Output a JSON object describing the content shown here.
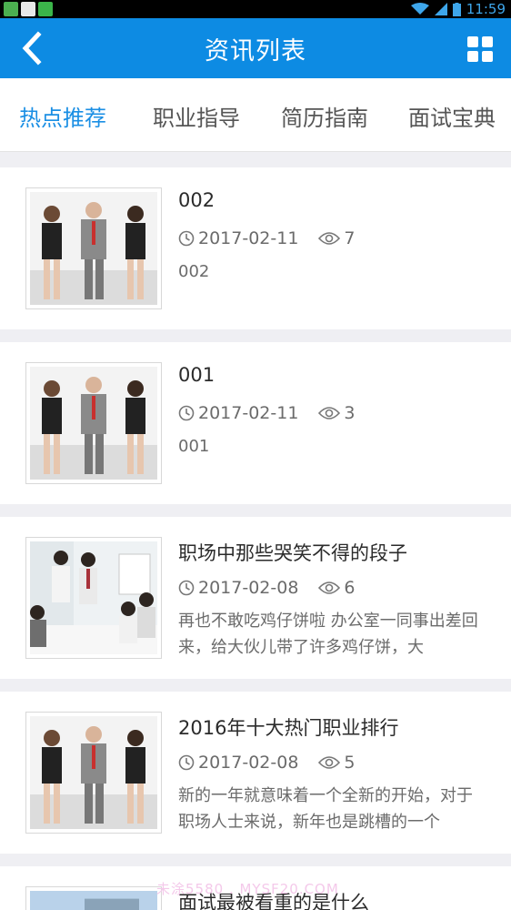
{
  "status_bar": {
    "time": "11:59"
  },
  "header": {
    "title": "资讯列表",
    "back_icon": "back-arrow-icon",
    "menu_icon": "grid-icon"
  },
  "tabs": [
    {
      "label": "热点推荐",
      "active": true
    },
    {
      "label": "职业指导",
      "active": false
    },
    {
      "label": "简历指南",
      "active": false
    },
    {
      "label": "面试宝典",
      "active": false
    }
  ],
  "articles": [
    {
      "title": "002",
      "date": "2017-02-11",
      "views": "7",
      "summary": "002",
      "image": "interview-candidates-photo"
    },
    {
      "title": "001",
      "date": "2017-02-11",
      "views": "3",
      "summary": "001",
      "image": "interview-candidates-photo"
    },
    {
      "title": "职场中那些哭笑不得的段子",
      "date": "2017-02-08",
      "views": "6",
      "summary": "再也不敢吃鸡仔饼啦 办公室一同事出差回来，给大伙儿带了许多鸡仔饼，大",
      "image": "office-meeting-photo"
    },
    {
      "title": "2016年十大热门职业排行",
      "date": "2017-02-08",
      "views": "5",
      "summary": "新的一年就意味着一个全新的开始，对于职场人士来说，新年也是跳槽的一个",
      "image": "interview-candidates-photo"
    },
    {
      "title": "面试最被看重的是什么",
      "image": "city-building-photo"
    }
  ],
  "watermark": "未涂5580 . MYSF20.COM",
  "colors": {
    "accent": "#0d8be3",
    "active_tab": "#1b8fe4",
    "background": "#efeff3"
  }
}
